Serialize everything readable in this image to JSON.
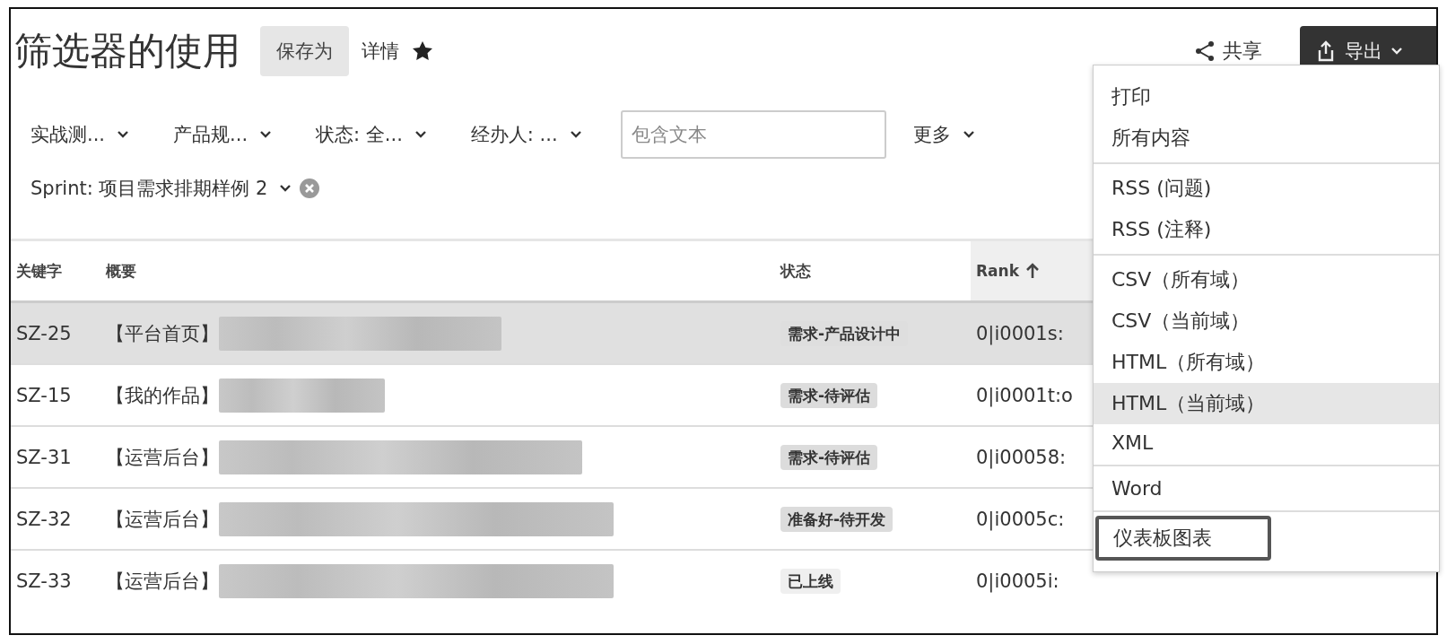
{
  "header": {
    "title": "筛选器的使用",
    "save_as": "保存为",
    "details": "详情",
    "starred": true,
    "share": "共享",
    "export": "导出"
  },
  "filters": [
    {
      "label": "实战测..."
    },
    {
      "label": "产品规..."
    },
    {
      "label": "状态: 全..."
    },
    {
      "label": "经办人: ..."
    }
  ],
  "search": {
    "placeholder": "包含文本"
  },
  "more": "更多",
  "sprint_filter": {
    "label": "Sprint: 项目需求排期样例 2"
  },
  "table": {
    "columns": [
      {
        "label": "关键字",
        "sorted": false
      },
      {
        "label": "概要",
        "sorted": false
      },
      {
        "label": "状态",
        "sorted": false
      },
      {
        "label": "Rank",
        "sorted": true
      }
    ],
    "rows": [
      {
        "key": "SZ-25",
        "summary": "【平台首页】",
        "status": "需求-产品设计中",
        "color": "#dedede",
        "rank": "0|i0001s:",
        "selected": true
      },
      {
        "key": "SZ-15",
        "summary": "【我的作品】",
        "status": "需求-待评估",
        "color": "#dcdcdc",
        "rank": "0|i0001t:o",
        "selected": false
      },
      {
        "key": "SZ-31",
        "summary": "【运营后台】",
        "status": "需求-待评估",
        "color": "#dcdcdc",
        "rank": "0|i00058:",
        "selected": false
      },
      {
        "key": "SZ-32",
        "summary": "【运营后台】",
        "status": "准备好-待开发",
        "color": "#dcdcdc",
        "rank": "0|i0005c:",
        "selected": false
      },
      {
        "key": "SZ-33",
        "summary": "【运营后台】",
        "status": "已上线",
        "color": "#efefef",
        "rank": "0|i0005i:",
        "selected": false
      }
    ]
  },
  "export_menu": {
    "groups": [
      [
        {
          "label": "打印",
          "selected": false,
          "outlined": false
        },
        {
          "label": "所有内容",
          "selected": false,
          "outlined": false
        }
      ],
      [
        {
          "label": "RSS (问题)",
          "selected": false,
          "outlined": false
        },
        {
          "label": "RSS (注释)",
          "selected": false,
          "outlined": false
        }
      ],
      [
        {
          "label": "CSV（所有域）",
          "selected": false,
          "outlined": false
        },
        {
          "label": "CSV（当前域）",
          "selected": false,
          "outlined": false
        },
        {
          "label": "HTML（所有域）",
          "selected": false,
          "outlined": false
        },
        {
          "label": "HTML（当前域）",
          "selected": true,
          "outlined": false
        },
        {
          "label": "XML",
          "selected": false,
          "outlined": false
        }
      ],
      [
        {
          "label": "Word",
          "selected": false,
          "outlined": false
        }
      ],
      [
        {
          "label": "仪表板图表",
          "selected": false,
          "outlined": true
        }
      ]
    ]
  }
}
